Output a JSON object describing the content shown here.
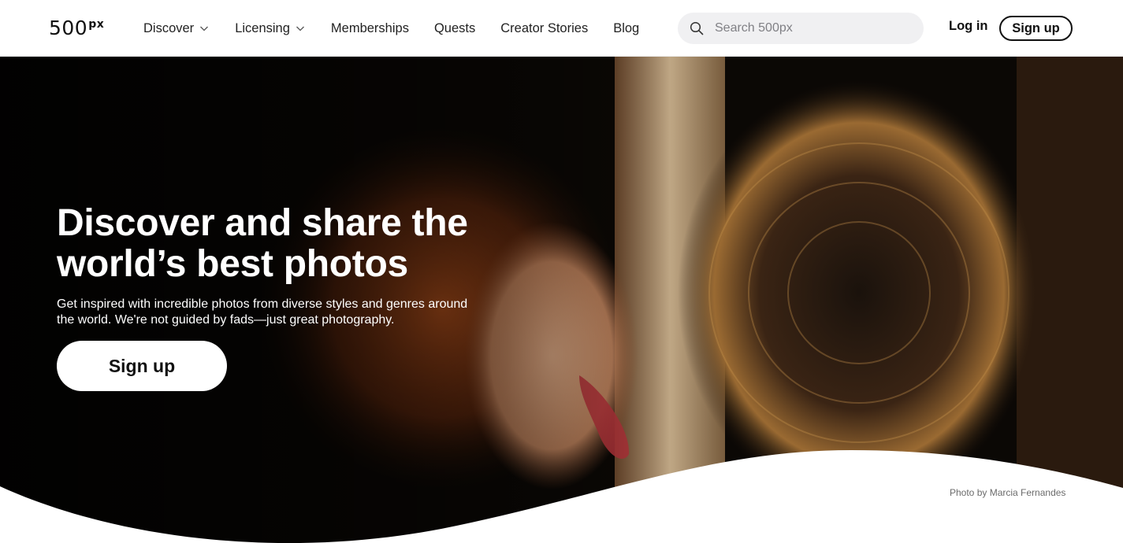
{
  "header": {
    "logo_text": "500",
    "logo_sup": "px",
    "nav": [
      {
        "label": "Discover",
        "has_dropdown": true
      },
      {
        "label": "Licensing",
        "has_dropdown": true
      },
      {
        "label": "Memberships",
        "has_dropdown": false
      },
      {
        "label": "Quests",
        "has_dropdown": false
      },
      {
        "label": "Creator Stories",
        "has_dropdown": false
      },
      {
        "label": "Blog",
        "has_dropdown": false
      }
    ],
    "search": {
      "placeholder": "Search 500px",
      "value": "",
      "icon": "search-icon"
    },
    "login_label": "Log in",
    "signup_label": "Sign up"
  },
  "hero": {
    "title": "Discover and share the world’s best photos",
    "subtitle": "Get inspired with incredible photos from diverse styles and genres around the world. We're not guided by fads—just great photography.",
    "signup_label": "Sign up",
    "credit": "Photo by Marcia Fernandes"
  },
  "colors": {
    "text_primary": "#111111",
    "search_bg": "#f0f0f2",
    "hero_overlay_text": "#ffffff",
    "credit_text": "#6b6b6b"
  }
}
